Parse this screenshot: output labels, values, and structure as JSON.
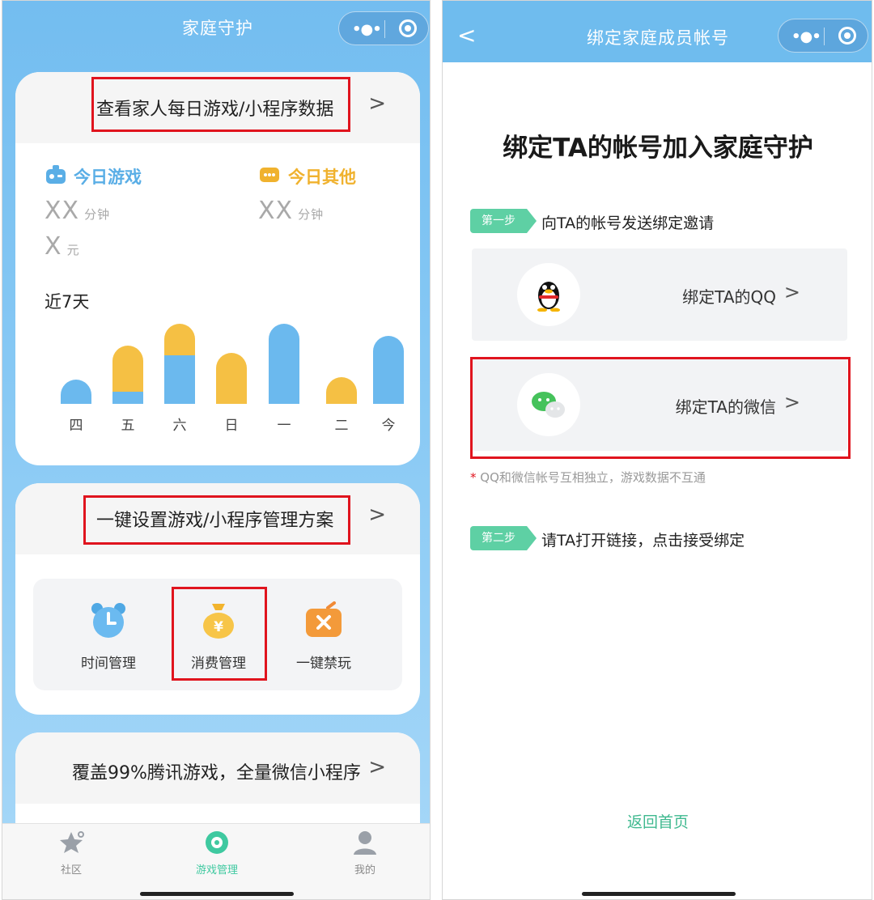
{
  "left": {
    "nav_title": "家庭守护",
    "card1": {
      "title": "查看家人每日游戏/小程序数据",
      "chevron": ">",
      "game_label": "今日游戏",
      "game_minutes": "XX",
      "game_min_unit": "分钟",
      "game_money": "X",
      "game_money_unit": "元",
      "other_label": "今日其他",
      "other_minutes": "XX",
      "other_min_unit": "分钟",
      "recent_title": "近7天"
    },
    "chart_data": {
      "type": "bar",
      "categories": [
        "四",
        "五",
        "六",
        "日",
        "一",
        "二",
        "今"
      ],
      "series": [
        {
          "values": [
            1,
            0.5,
            2,
            0,
            3.3,
            0,
            2.8
          ]
        },
        {
          "values": [
            0,
            1.9,
            1.3,
            2.1,
            0,
            1.1,
            0
          ]
        }
      ],
      "colors": [
        "#6bb9ee",
        "#f5c044"
      ]
    },
    "card2": {
      "title": "一键设置游戏/小程序管理方案",
      "chevron": ">",
      "items": [
        {
          "label": "时间管理"
        },
        {
          "label": "消费管理"
        },
        {
          "label": "一键禁玩"
        }
      ]
    },
    "card3": {
      "title": "覆盖99%腾讯游戏，全量微信小程序",
      "chevron": ">"
    },
    "tabs": [
      {
        "label": "社区",
        "icon": "community-icon"
      },
      {
        "label": "游戏管理",
        "icon": "game-manage-icon"
      },
      {
        "label": "我的",
        "icon": "profile-icon"
      }
    ],
    "active_tab_color": "#3fc9a0"
  },
  "right": {
    "nav_title": "绑定家庭成员帐号",
    "back": "<",
    "heading": "绑定TA的帐号加入家庭守护",
    "step1_tag": "第一步",
    "step1_text": "向TA的帐号发送绑定邀请",
    "bind_qq": "绑定TA的QQ",
    "bind_wechat": "绑定TA的微信",
    "chevron": ">",
    "note_star": "*",
    "note": "QQ和微信帐号互相独立，游戏数据不互通",
    "step2_tag": "第二步",
    "step2_text": "请TA打开链接，点击接受绑定",
    "back_home": "返回首页"
  }
}
